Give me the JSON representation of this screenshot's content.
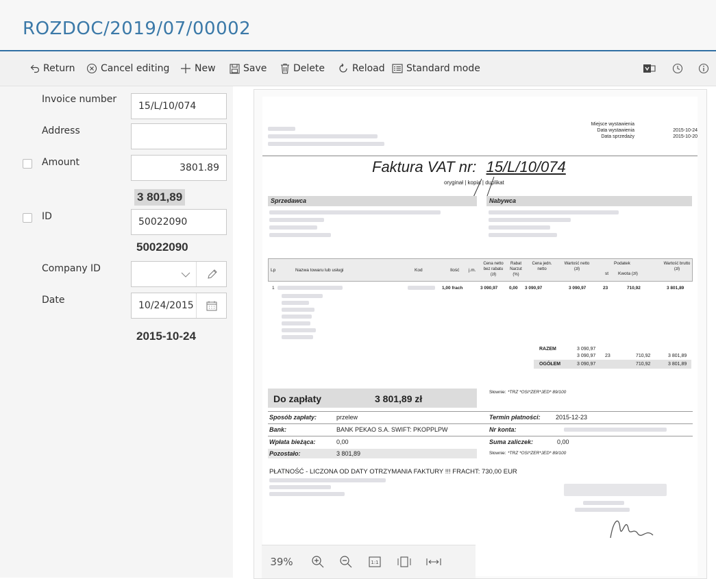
{
  "title": "ROZDOC/2019/07/00002",
  "toolbar": {
    "return": "Return",
    "cancel": "Cancel editing",
    "new": "New",
    "save": "Save",
    "delete": "Delete",
    "reload": "Reload",
    "mode": "Standard mode"
  },
  "form": {
    "invoice_number": {
      "label": "Invoice number",
      "value": "15/L/10/074"
    },
    "address": {
      "label": "Address",
      "value": ""
    },
    "amount": {
      "label": "Amount",
      "value": "3801.89",
      "ocr": "3 801,89"
    },
    "id": {
      "label": "ID",
      "value": "50022090",
      "ocr": "50022090"
    },
    "company_id": {
      "label": "Company ID",
      "value": ""
    },
    "date": {
      "label": "Date",
      "value": "10/24/2015",
      "ocr": "2015-10-24"
    }
  },
  "document": {
    "place_label": "Miejsce wystawienia",
    "issue_label": "Data wystawienia",
    "sale_label": "Data sprzedaży",
    "issue_date": "2015-10-24",
    "sale_date": "2015-10-20",
    "heading_prefix": "Faktura VAT nr:",
    "heading_number": "15/L/10/074",
    "copy_line": "oryginał | kopia | duplikat",
    "seller": "Sprzedawca",
    "buyer": "Nabywca",
    "cols": {
      "lp": "Lp",
      "name": "Nazwa towaru lub usługi",
      "kod": "Kod",
      "qty": "Ilość",
      "unit": "j.m.",
      "net_price": "Cena netto bez rabatu (zł)",
      "rabat": "Rabat Narzut (%)",
      "unit_net": "Cena jedn. netto",
      "net_value": "Wartość netto (zł)",
      "tax": "Podatek",
      "st": "st",
      "kwota": "Kwota (zł)",
      "gross": "Wartość brutto (zł)"
    },
    "row": {
      "lp": "1",
      "qty": "1,00 frach",
      "price": "3 090,97",
      "rabat": "0,00",
      "unit": "3 090,97",
      "net": "3 090,97",
      "st": "23",
      "tax": "710,92",
      "gross": "3 801,89"
    },
    "razem": "RAZEM",
    "ogolem": "OGÓŁEM",
    "sum_net": "3 090,97",
    "sum_net2": "3 090,97",
    "sum_st": "23",
    "sum_tax": "710,92",
    "sum_gross": "3 801,89",
    "og_net": "3 090,97",
    "og_tax": "710,92",
    "og_gross": "3 801,89",
    "to_pay_label": "Do zapłaty",
    "to_pay_value": "3 801,89 zł",
    "words_label": "Słownie:",
    "words": "*TRZ *OSI*ZER*JED* 89/100",
    "payment_label": "Sposób zapłaty:",
    "payment_value": "przelew",
    "due_label": "Termin płatności:",
    "due_value": "2015-12-23",
    "bank_label": "Bank:",
    "bank_value": "BANK PEKAO S.A. SWIFT: PKOPPLPW",
    "account_label": "Nr konta:",
    "paid_label": "Wpłata bieżąca:",
    "paid_value": "0,00",
    "advance_label": "Suma zaliczek:",
    "advance_value": "0,00",
    "remaining_label": "Pozostało:",
    "remaining_value": "3 801,89",
    "words2_label": "Słownie:",
    "words2": "*TRZ *OSI*ZER*JED* 89/100",
    "footer_note": "PŁATNOŚĆ - LICZONA OD DATY OTRZYMANIA FAKTURY !!! FRACHT: 730,00 EUR"
  },
  "zoom": {
    "level": "39%"
  }
}
